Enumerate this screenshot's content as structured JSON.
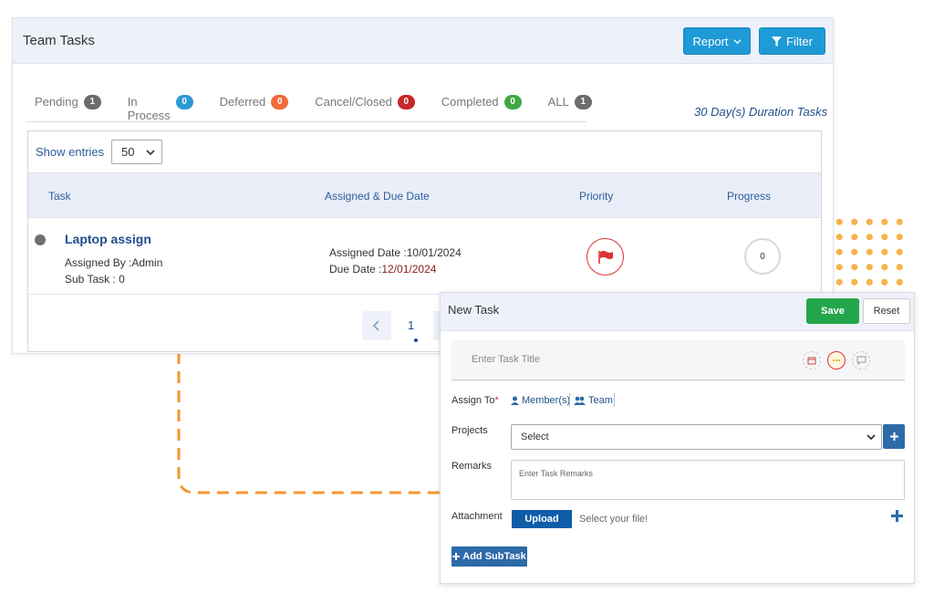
{
  "team_panel": {
    "title": "Team Tasks",
    "report_label": "Report",
    "filter_label": "Filter",
    "tabs": [
      {
        "label": "Pending",
        "count": "1",
        "color": "#6c6c6c"
      },
      {
        "label": "In Process",
        "count": "0",
        "color": "#2d9ad5"
      },
      {
        "label": "Deferred",
        "count": "0",
        "color": "#f06a3b"
      },
      {
        "label": "Cancel/Closed",
        "count": "0",
        "color": "#c62828"
      },
      {
        "label": "Completed",
        "count": "0",
        "color": "#3fa745"
      },
      {
        "label": "ALL",
        "count": "1",
        "color": "#6c6c6c"
      }
    ],
    "duration": "30 Day(s) Duration Tasks",
    "show_entries_label": "Show entries",
    "entries_value": "50",
    "columns": [
      "Task",
      "Assigned & Due Date",
      "Priority",
      "Progress"
    ],
    "row": {
      "task_name": "Laptop assign",
      "assigned_by": "Assigned By :Admin",
      "sub_task": "Sub Task : 0",
      "assigned_date_label": "Assigned Date :",
      "assigned_date": "10/01/2024",
      "due_date_label": "Due Date :",
      "due_date": "12/01/2024",
      "progress": "0"
    },
    "page": "1"
  },
  "new_task": {
    "title": "New Task",
    "save_label": "Save",
    "reset_label": "Reset",
    "task_title_placeholder": "Enter Task Title",
    "assign_to_label": "Assign To",
    "assign_required": "*",
    "members_label": "Member(s)",
    "team_label": "Team",
    "projects_label": "Projects",
    "projects_value": "Select",
    "remarks_label": "Remarks",
    "remarks_placeholder": "Enter Task Remarks",
    "attachment_label": "Attachment",
    "upload_label": "Upload",
    "file_hint": "Select your file!",
    "add_subtask_label": "Add SubTask"
  },
  "colors": {
    "accent_blue": "#1e9ad6",
    "save_green": "#22a64a",
    "dark_blue": "#2c6aa8",
    "dots_orange": "#f7b24a"
  }
}
